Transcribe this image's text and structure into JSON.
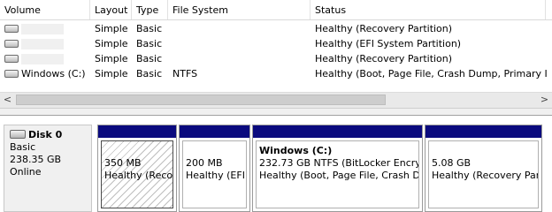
{
  "columns": [
    "Volume",
    "Layout",
    "Type",
    "File System",
    "Status"
  ],
  "volumes": [
    {
      "name": "",
      "layout": "Simple",
      "type": "Basic",
      "fs": "",
      "status": "Healthy (Recovery Partition)"
    },
    {
      "name": "",
      "layout": "Simple",
      "type": "Basic",
      "fs": "",
      "status": "Healthy (EFI System Partition)"
    },
    {
      "name": "",
      "layout": "Simple",
      "type": "Basic",
      "fs": "",
      "status": "Healthy (Recovery Partition)"
    },
    {
      "name": "Windows (C:)",
      "layout": "Simple",
      "type": "Basic",
      "fs": "NTFS",
      "status": "Healthy (Boot, Page File, Crash Dump, Primary I"
    }
  ],
  "scrollbar": {
    "left_arrow": "<",
    "right_arrow": ">"
  },
  "disk": {
    "name": "Disk 0",
    "type": "Basic",
    "size": "238.35 GB",
    "state": "Online"
  },
  "partitions": [
    {
      "name": "",
      "line1": "350 MB",
      "line2": "Healthy (Reco"
    },
    {
      "name": "",
      "line1": "200 MB",
      "line2": "Healthy (EFI"
    },
    {
      "name": "Windows  (C:)",
      "line1": "232.73 GB NTFS (BitLocker Encry|",
      "line2": "Healthy (Boot, Page File, Crash D"
    },
    {
      "name": "",
      "line1": "5.08 GB",
      "line2": "Healthy (Recovery Par"
    }
  ],
  "colors": {
    "partition_bar": "#0a0a7e",
    "pane_bg": "#f0f0f0"
  }
}
